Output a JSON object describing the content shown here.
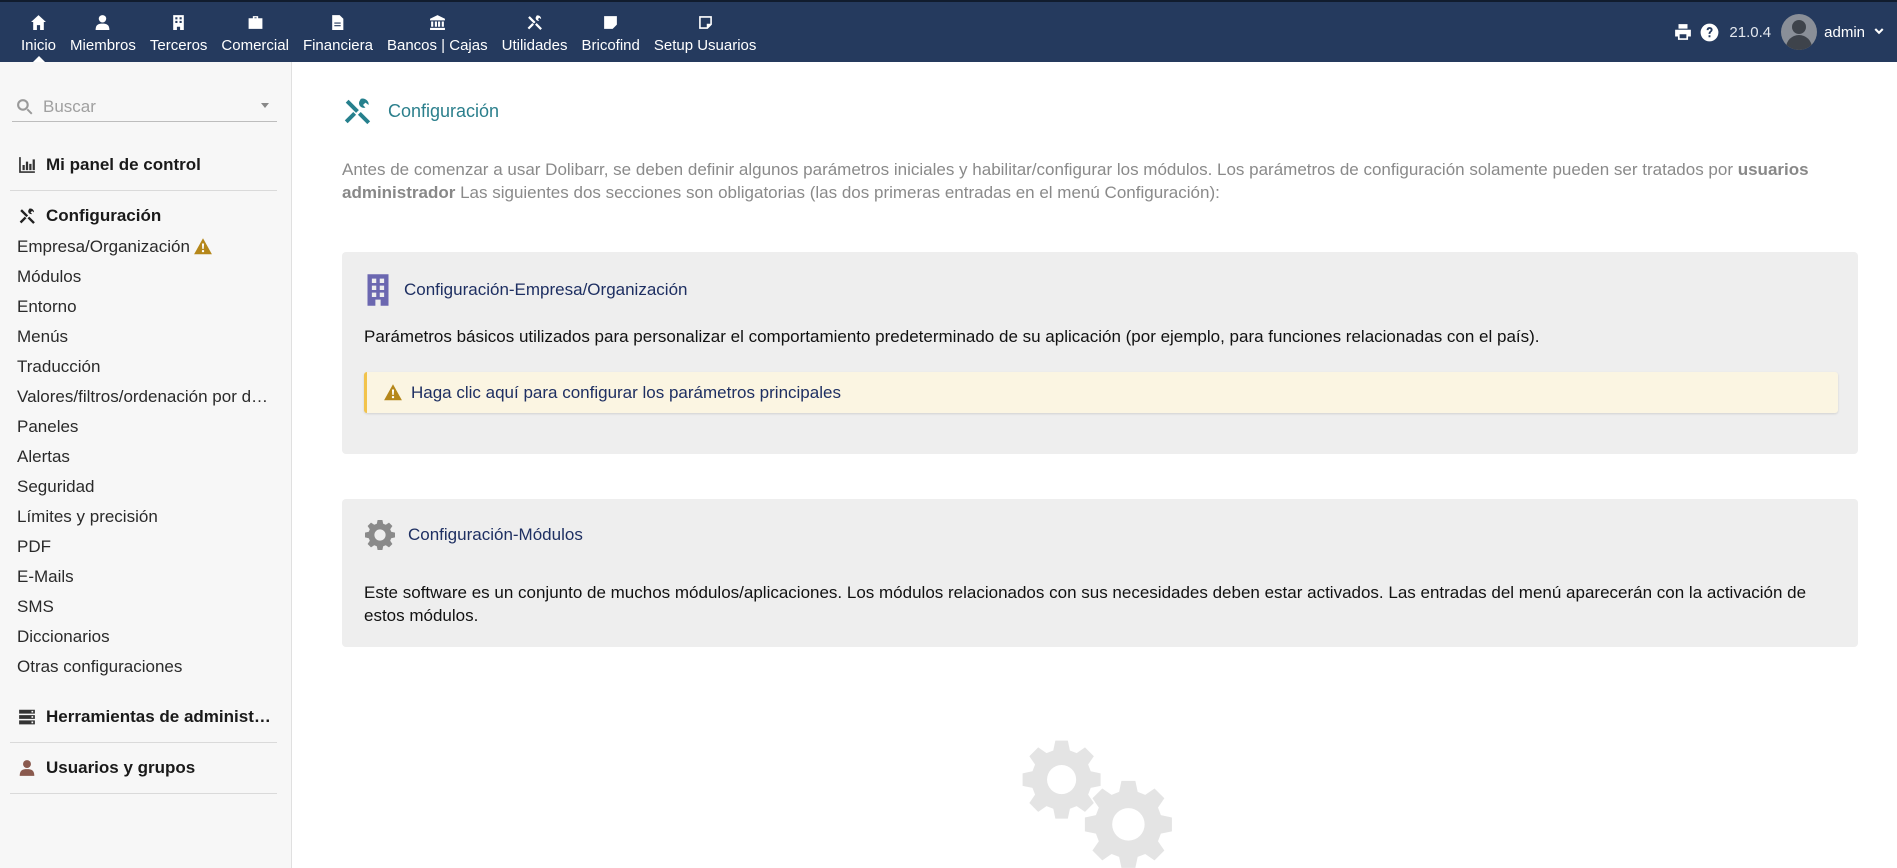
{
  "topmenu": {
    "items": [
      {
        "label": "Inicio",
        "icon": "home-icon",
        "active": true
      },
      {
        "label": "Miembros",
        "icon": "user-icon"
      },
      {
        "label": "Terceros",
        "icon": "building-icon"
      },
      {
        "label": "Comercial",
        "icon": "briefcase-icon"
      },
      {
        "label": "Financiera",
        "icon": "file-invoice-icon"
      },
      {
        "label": "Bancos | Cajas",
        "icon": "bank-icon"
      },
      {
        "label": "Utilidades",
        "icon": "tools-icon"
      },
      {
        "label": "Bricofind",
        "icon": "note-icon"
      },
      {
        "label": "Setup Usuarios",
        "icon": "note-icon"
      }
    ],
    "version": "21.0.4",
    "username": "admin"
  },
  "sidebar": {
    "search_placeholder": "Buscar",
    "dashboard": "Mi panel de control",
    "setup_title": "Configuración",
    "setup_items": [
      "Empresa/Organización",
      "Módulos",
      "Entorno",
      "Menús",
      "Traducción",
      "Valores/filtros/ordenación por defecto",
      "Paneles",
      "Alertas",
      "Seguridad",
      "Límites y precisión",
      "PDF",
      "E-Mails",
      "SMS",
      "Diccionarios",
      "Otras configuraciones"
    ],
    "admin_tools": "Herramientas de administración",
    "users_groups": "Usuarios y grupos"
  },
  "main": {
    "title": "Configuración",
    "intro_part1": "Antes de comenzar a usar Dolibarr, se deben definir algunos parámetros iniciales y habilitar/configurar los módulos. Los parámetros de configuración solamente pueden ser tratados por ",
    "intro_bold": "usuarios administrador",
    "intro_part2": " Las siguientes dos secciones son obligatorias (las dos primeras entradas en el menú Configuración):",
    "company_card": {
      "title": "Configuración-Empresa/Organización",
      "text": "Parámetros básicos utilizados para personalizar el comportamiento predeterminado de su aplicación (por ejemplo, para funciones relacionadas con el país).",
      "notice": "Haga clic aquí para configurar los parámetros principales"
    },
    "modules_card": {
      "title": "Configuración-Módulos",
      "text": "Este software es un conjunto de muchos módulos/aplicaciones. Los módulos relacionados con sus necesidades deben estar activados. Las entradas del menú aparecerán con la activación de estos módulos."
    }
  },
  "colors": {
    "topbar": "#253a5e",
    "title_teal": "#2b7f8c",
    "link_navy": "#1e2f62",
    "warning": "#b5871a",
    "company_icon": "#6b67b0"
  }
}
